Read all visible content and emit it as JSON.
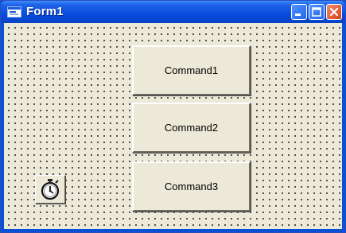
{
  "window": {
    "title": "Form1",
    "icon": "form-icon",
    "controls": [
      "minimize-icon",
      "maximize-icon",
      "close-icon"
    ]
  },
  "form": {
    "buttons": [
      {
        "label": "Command1"
      },
      {
        "label": "Command2"
      },
      {
        "label": "Command3"
      }
    ],
    "timer_control": {
      "icon": "stopwatch-icon"
    }
  },
  "colors": {
    "titlebar": "#0a4ee0",
    "form_background": "#ece9d8",
    "close_button": "#d5411c"
  }
}
